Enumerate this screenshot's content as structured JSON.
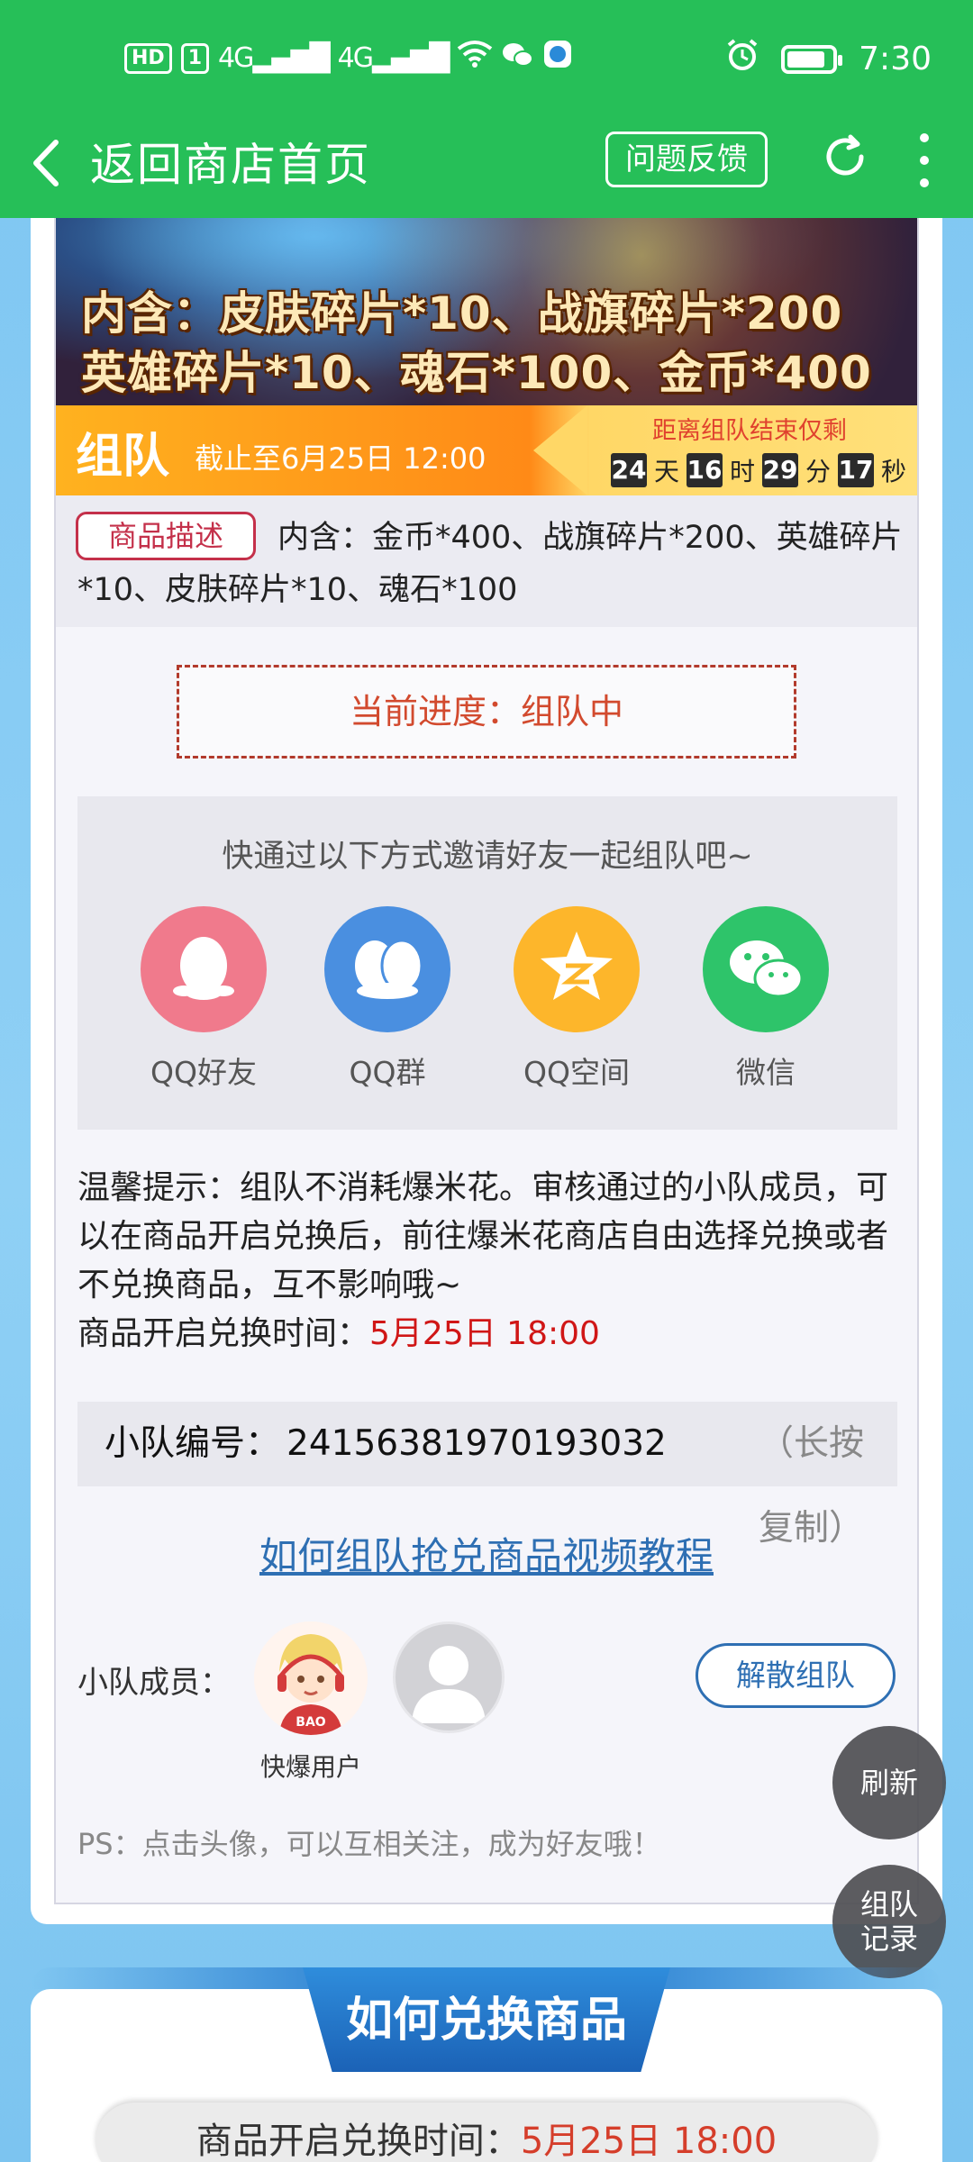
{
  "status_bar": {
    "hd_chip": "HD",
    "sim": "1",
    "net1": "4G",
    "net2": "4G",
    "time": "7:30",
    "battery_level": 0.85
  },
  "nav": {
    "back_label": "返回商店首页",
    "feedback_label": "问题反馈"
  },
  "banner": {
    "line1": "内含：皮肤碎片*10、战旗碎片*200",
    "line2": "英雄碎片*10、魂石*100、金币*400"
  },
  "team_bar": {
    "label": "组队",
    "deadline": "截止至6月25日 12:00",
    "countdown_label": "距离组队结束仅剩",
    "days": "24",
    "days_unit": "天",
    "hours": "16",
    "hours_unit": "时",
    "minutes": "29",
    "minutes_unit": "分",
    "seconds": "17",
    "seconds_unit": "秒"
  },
  "description": {
    "tag": "商品描述",
    "text": "内含：金币*400、战旗碎片*200、英雄碎片*10、皮肤碎片*10、魂石*100"
  },
  "progress": {
    "text": "当前进度：组队中"
  },
  "invite": {
    "title": "快通过以下方式邀请好友一起组队吧~",
    "options": [
      {
        "label": "QQ好友",
        "icon": "qq-penguin-icon",
        "color": "#f07a8c"
      },
      {
        "label": "QQ群",
        "icon": "qq-group-icon",
        "color": "#4a8fe0"
      },
      {
        "label": "QQ空间",
        "icon": "qzone-star-icon",
        "color": "#fdb62b"
      },
      {
        "label": "微信",
        "icon": "wechat-icon",
        "color": "#2ec46a"
      }
    ]
  },
  "tips": {
    "text": "温馨提示：组队不消耗爆米花。审核通过的小队成员，可以在商品开启兑换后，前往爆米花商店自由选择兑换或者不兑换商品，互不影响哦~",
    "time_label": "商品开启兑换时间：",
    "time_value": "5月25日 18:00"
  },
  "team_id": {
    "label": "小队编号：",
    "value": "24156381970193032",
    "hint": "（长按复制）"
  },
  "video_link": "如何组队抢兑商品视频教程",
  "members": {
    "label": "小队成员：",
    "member1_name": "快爆用户",
    "disband_label": "解散组队",
    "ps": "PS：点击头像，可以互相关注，成为好友哦！"
  },
  "floating": {
    "refresh": "刷新",
    "records_line1": "组队",
    "records_line2": "记录"
  },
  "how_to": {
    "title": "如何兑换商品",
    "time_label": "商品开启兑换时间：",
    "time_value": "5月25日 18:00"
  },
  "colors": {
    "brand_green": "#26bf58",
    "accent_red": "#d01616",
    "link_blue": "#2e6fb3"
  }
}
